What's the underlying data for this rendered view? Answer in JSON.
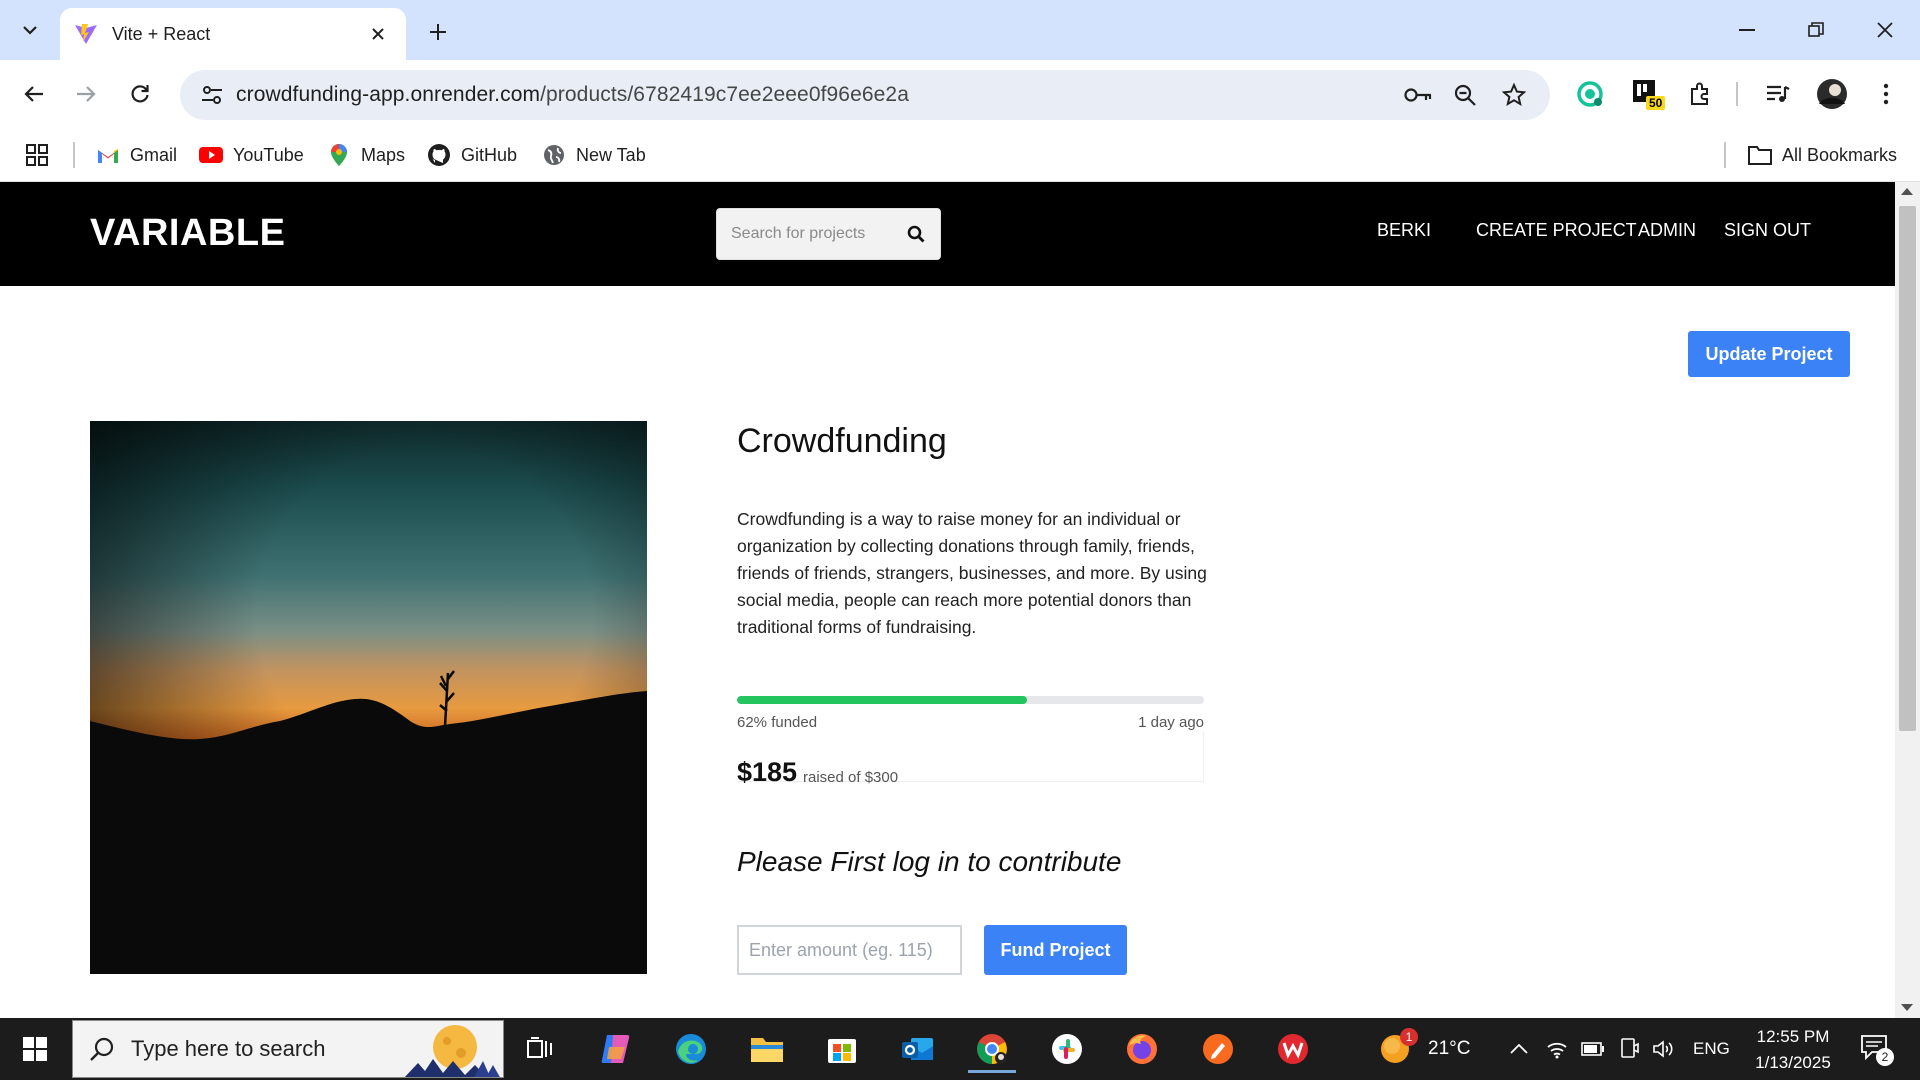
{
  "browser": {
    "tab_title": "Vite + React",
    "url_host": "crowdfunding-app.onrender.com",
    "url_path": "/products/6782419c7ee2eee0f96e6e2a",
    "extension_badge": "50",
    "bookmarks": [
      {
        "label": "Gmail",
        "icon": "gmail-icon"
      },
      {
        "label": "YouTube",
        "icon": "youtube-icon"
      },
      {
        "label": "Maps",
        "icon": "maps-icon"
      },
      {
        "label": "GitHub",
        "icon": "github-icon"
      },
      {
        "label": "New Tab",
        "icon": "globe-icon"
      }
    ],
    "all_bookmarks_label": "All Bookmarks"
  },
  "site": {
    "logo": "VARIABLE",
    "search_placeholder": "Search for projects",
    "nav": {
      "user": "BERKI",
      "create": "CREATE PROJECT",
      "admin": "ADMIN",
      "signout": "SIGN OUT"
    },
    "update_button": "Update Project"
  },
  "project": {
    "title": "Crowdfunding",
    "description": "Crowdfunding is a way to raise money for an individual or organization by collecting donations through family, friends, friends of friends, strangers, businesses, and more. By using social media, people can reach more potential donors than traditional forms of fundraising.",
    "funded_percent": 62,
    "funded_label": "62% funded",
    "time_ago": "1 day ago",
    "raised": "$185",
    "raised_of": "raised of $300",
    "login_message": "Please First log in to contribute",
    "amount_placeholder": "Enter amount (eg. 115)",
    "fund_button": "Fund Project"
  },
  "taskbar": {
    "search_placeholder": "Type here to search",
    "weather_temp": "21°C",
    "weather_badge": "1",
    "language": "ENG",
    "time": "12:55 PM",
    "date": "1/13/2025",
    "notification_count": "2"
  },
  "colors": {
    "accent_blue": "#3b82f6",
    "progress_green": "#22c55e",
    "header_black": "#000000"
  }
}
